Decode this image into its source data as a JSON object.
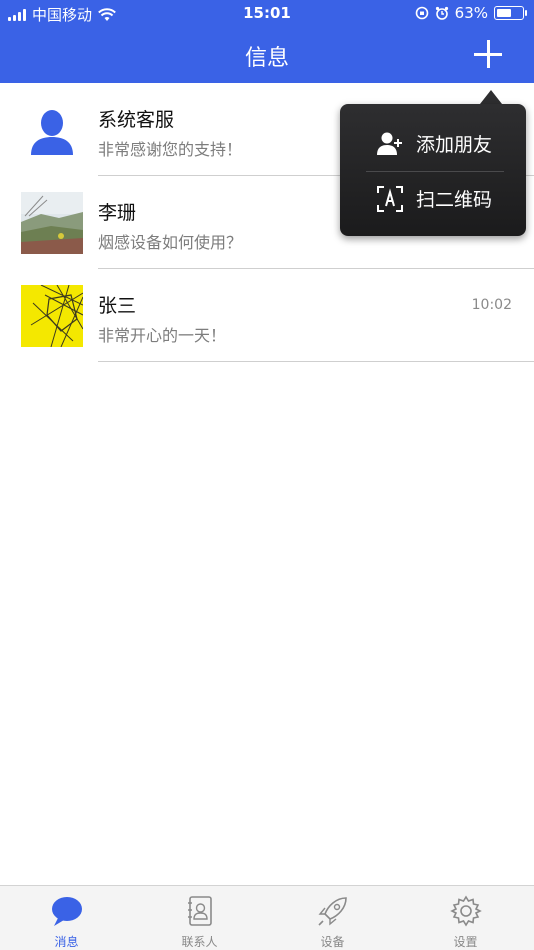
{
  "status_bar": {
    "carrier": "中国移动",
    "time": "15:01",
    "battery": "63%",
    "battery_level": 0.63
  },
  "header": {
    "title": "信息",
    "add_icon": "plus-icon"
  },
  "conversations": [
    {
      "name": "系统客服",
      "preview": "非常感谢您的支持！",
      "time": "",
      "avatar": "person-silhouette"
    },
    {
      "name": "李珊",
      "preview": "烟感设备如何使用？",
      "time": "",
      "avatar": "landscape-photo"
    },
    {
      "name": "张三",
      "preview": "非常开心的一天！",
      "time": "10:02",
      "avatar": "yellow-wire-photo"
    }
  ],
  "popup_menu": {
    "items": [
      {
        "label": "添加朋友",
        "icon": "add-friend-icon"
      },
      {
        "label": "扫二维码",
        "icon": "scan-qr-icon"
      }
    ]
  },
  "tabbar": {
    "tabs": [
      {
        "label": "消息",
        "icon": "message-bubble-icon",
        "active": true
      },
      {
        "label": "联系人",
        "icon": "contacts-book-icon",
        "active": false
      },
      {
        "label": "设备",
        "icon": "rocket-icon",
        "active": false
      },
      {
        "label": "设置",
        "icon": "gear-icon",
        "active": false
      }
    ]
  },
  "colors": {
    "primary": "#3a62e6",
    "popup_bg": "#222224",
    "tab_inactive": "#888888"
  }
}
